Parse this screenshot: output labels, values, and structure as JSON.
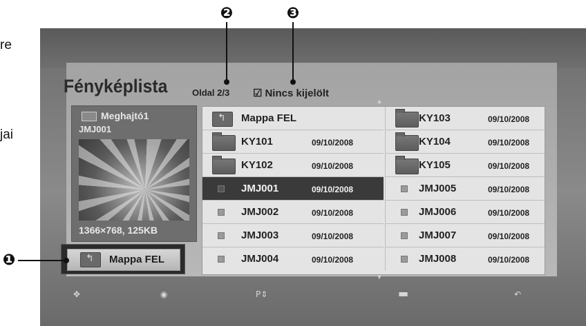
{
  "margin_text": {
    "line1": "re",
    "line2": "jai"
  },
  "callouts": [
    "❶",
    "❷",
    "❸"
  ],
  "screen": {
    "title": "Fényképlista",
    "page_indicator": "Oldal 2/3",
    "selection_status": "Nincs kijelölt",
    "checkbox_icon": "☑"
  },
  "preview": {
    "drive_label": "Meghajtó1",
    "file_name": "JMJ001",
    "resolution_size": "1366×768, 125KB"
  },
  "up_button": {
    "label": "Mappa FEL"
  },
  "file_list": {
    "left_column": [
      {
        "type": "folder-up",
        "name": "Mappa FEL",
        "date": ""
      },
      {
        "type": "folder",
        "name": "KY101",
        "date": "09/10/2008"
      },
      {
        "type": "folder",
        "name": "KY102",
        "date": "09/10/2008"
      },
      {
        "type": "file",
        "name": "JMJ001",
        "date": "09/10/2008",
        "selected": true
      },
      {
        "type": "file",
        "name": "JMJ002",
        "date": "09/10/2008"
      },
      {
        "type": "file",
        "name": "JMJ003",
        "date": "09/10/2008"
      },
      {
        "type": "file",
        "name": "JMJ004",
        "date": "09/10/2008"
      }
    ],
    "right_column": [
      {
        "type": "folder",
        "name": "KY103",
        "date": "09/10/2008"
      },
      {
        "type": "folder",
        "name": "KY104",
        "date": "09/10/2008"
      },
      {
        "type": "folder",
        "name": "KY105",
        "date": "09/10/2008"
      },
      {
        "type": "file",
        "name": "JMJ005",
        "date": "09/10/2008"
      },
      {
        "type": "file",
        "name": "JMJ006",
        "date": "09/10/2008"
      },
      {
        "type": "file",
        "name": "JMJ007",
        "date": "09/10/2008"
      },
      {
        "type": "file",
        "name": "JMJ008",
        "date": "09/10/2008"
      }
    ],
    "scroll_up_icon": "▲",
    "scroll_down_icon": "▼"
  },
  "bottom_bar": {
    "move_icon": "✥",
    "ok_icon": "◉",
    "page_icon": "P⇕",
    "color_key_icon": "▬",
    "back_icon": "↶"
  }
}
